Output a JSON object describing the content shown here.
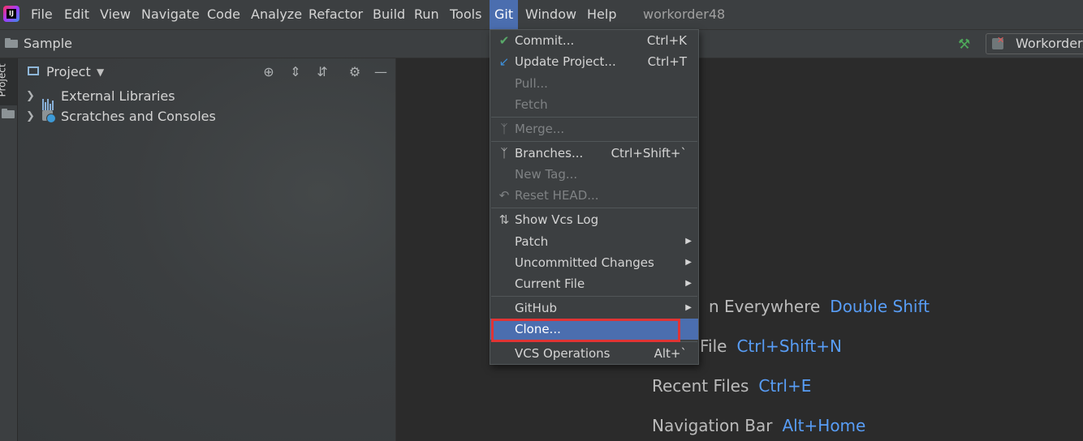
{
  "menubar": {
    "items": [
      "File",
      "Edit",
      "View",
      "Navigate",
      "Code",
      "Analyze",
      "Refactor",
      "Build",
      "Run",
      "Tools",
      "Git",
      "Window",
      "Help"
    ],
    "active": "Git",
    "project_title": "workorder48"
  },
  "navbar": {
    "breadcrumb": "Sample",
    "run_config": "WorkorderApp"
  },
  "sidebar": {
    "tab_label": "Project"
  },
  "project_panel": {
    "title": "Project",
    "tree": [
      {
        "label": "External Libraries",
        "icon": "library-icon"
      },
      {
        "label": "Scratches and Consoles",
        "icon": "scratches-icon"
      }
    ]
  },
  "git_menu": {
    "items": [
      {
        "label": "Commit...",
        "shortcut": "Ctrl+K",
        "icon": "check-icon",
        "enabled": true
      },
      {
        "label": "Update Project...",
        "shortcut": "Ctrl+T",
        "icon": "update-arrow-icon",
        "enabled": true
      },
      {
        "label": "Pull...",
        "shortcut": "",
        "enabled": false
      },
      {
        "label": "Fetch",
        "shortcut": "",
        "enabled": false
      },
      {
        "label": "Merge...",
        "shortcut": "",
        "icon": "merge-icon",
        "enabled": false
      },
      {
        "label": "Branches...",
        "shortcut": "Ctrl+Shift+`",
        "icon": "branch-icon",
        "enabled": true
      },
      {
        "label": "New Tag...",
        "shortcut": "",
        "enabled": false
      },
      {
        "label": "Reset HEAD...",
        "shortcut": "",
        "icon": "undo-icon",
        "enabled": false
      },
      {
        "label": "Show Vcs Log",
        "shortcut": "",
        "icon": "vcs-log-icon",
        "enabled": true
      },
      {
        "label": "Patch",
        "submenu": true,
        "enabled": true
      },
      {
        "label": "Uncommitted Changes",
        "submenu": true,
        "enabled": true
      },
      {
        "label": "Current File",
        "submenu": true,
        "enabled": true
      },
      {
        "label": "GitHub",
        "submenu": true,
        "enabled": true
      },
      {
        "label": "Clone...",
        "shortcut": "",
        "enabled": true,
        "selected": true
      },
      {
        "label": "VCS Operations",
        "shortcut": "Alt+`",
        "enabled": true
      }
    ]
  },
  "editor_hints": [
    {
      "label": "n Everywhere",
      "key": "Double Shift"
    },
    {
      "label": "File",
      "key": "Ctrl+Shift+N"
    },
    {
      "label": "Recent Files",
      "key": "Ctrl+E"
    },
    {
      "label": "Navigation Bar",
      "key": "Alt+Home"
    }
  ],
  "colors": {
    "accent": "#4b6eaf",
    "highlight_box": "#e03434",
    "shortcut_blue": "#589df6",
    "menubar_bg": "#3c3f41",
    "editor_bg": "#2b2b2b"
  }
}
